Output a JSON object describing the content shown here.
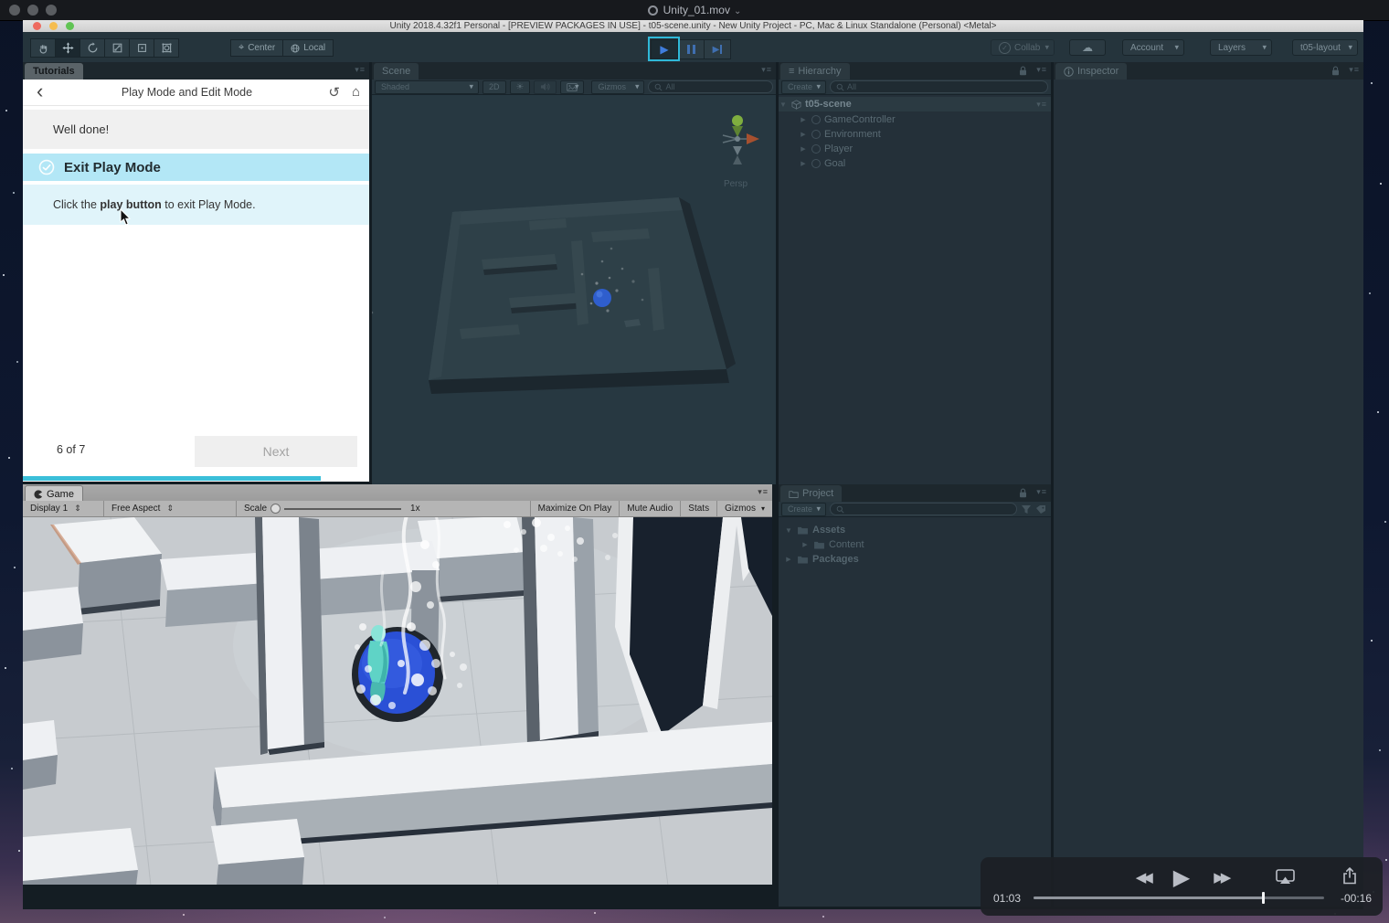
{
  "qt_titlebar": {
    "title": "Unity_01.mov"
  },
  "unity_titlebar": {
    "title": "Unity 2018.4.32f1 Personal - [PREVIEW PACKAGES IN USE] - t05-scene.unity - New Unity Project - PC, Mac & Linux Standalone (Personal) <Metal>"
  },
  "toolbar": {
    "center_label": "Center",
    "local_label": "Local",
    "collab_label": "Collab",
    "account_label": "Account",
    "layers_label": "Layers",
    "layout_label": "t05-layout"
  },
  "tutorials": {
    "tab_label": "Tutorials",
    "header_title": "Play Mode and Edit Mode",
    "well_done": "Well done!",
    "step_title": "Exit Play Mode",
    "instruction_prefix": "Click the ",
    "instruction_bold": "play button",
    "instruction_suffix": " to exit Play Mode.",
    "progress_label": "6 of 7",
    "next_label": "Next",
    "progress_percent": 86
  },
  "scene_panel": {
    "tab_label": "Scene",
    "draw_mode": "Shaded",
    "mode_2d": "2D",
    "gizmos_label": "Gizmos",
    "search_text": "All",
    "persp_label": "Persp"
  },
  "hierarchy_panel": {
    "tab_label": "Hierarchy",
    "create_label": "Create",
    "search_text": "All",
    "scene_row": "t05-scene",
    "items": [
      {
        "label": "GameController"
      },
      {
        "label": "Environment"
      },
      {
        "label": "Player"
      },
      {
        "label": "Goal"
      }
    ]
  },
  "inspector_panel": {
    "tab_label": "Inspector"
  },
  "game_panel": {
    "tab_label": "Game",
    "display_label": "Display 1",
    "aspect_label": "Free Aspect",
    "scale_label": "Scale",
    "scale_value": "1x",
    "maximize_label": "Maximize On Play",
    "mute_label": "Mute Audio",
    "stats_label": "Stats",
    "gizmos_label": "Gizmos"
  },
  "project_panel": {
    "tab_label": "Project",
    "create_label": "Create",
    "items": [
      {
        "label": "Assets"
      },
      {
        "label": "Content"
      },
      {
        "label": "Packages"
      }
    ]
  },
  "qt_controls": {
    "elapsed": "01:03",
    "remaining": "-00:16",
    "progress_percent": 79
  },
  "colors": {
    "tutorial_accent": "#3bbfd9",
    "play_highlight": "#2fb8d8",
    "goal_blue": "#2a50d6"
  }
}
